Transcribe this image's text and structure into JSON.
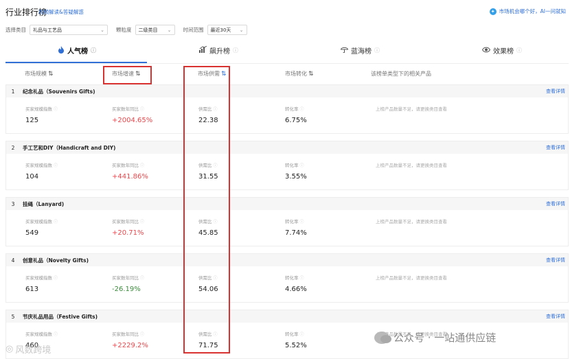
{
  "header": {
    "title": "行业排行榜",
    "guide_link": "视频解读&答疑解惑",
    "top_right_text": "市场机会哪个好，AI一问就知"
  },
  "filters": {
    "category_label": "选择类目",
    "category_value": "礼品与工艺品",
    "granularity_label": "颗粒度",
    "granularity_value": "二级类目",
    "time_label": "时间范围",
    "time_value": "最近30天"
  },
  "tabs": [
    {
      "label": "人气榜",
      "icon": "fire-icon"
    },
    {
      "label": "飙升榜",
      "icon": "rising-chart-icon"
    },
    {
      "label": "蓝海榜",
      "icon": "umbrella-icon"
    },
    {
      "label": "效果榜",
      "icon": "eye-icon"
    }
  ],
  "columns": {
    "market_scale": "市场规模",
    "market_growth": "市场增速",
    "market_supply": "市场供需",
    "market_conversion": "市场转化",
    "related_products": "该榜单类型下的相关产品"
  },
  "metric_labels": {
    "buyer_index": "买家规模指数",
    "buyer_yoy": "买家数年同比",
    "supply_ratio": "供需比",
    "conversion": "转化率"
  },
  "detail_label": "查看详情",
  "product_message": "上榜产品数量不足，请更换类目查看",
  "rows": [
    {
      "rank": "1",
      "name": "纪念礼品（Souvenirs Gifts)",
      "buyer_index": "125",
      "buyer_yoy": "+2004.65%",
      "yoy_color": "red",
      "supply_ratio": "22.38",
      "conversion": "6.75%"
    },
    {
      "rank": "2",
      "name": "手工艺和DIY（Handicraft and DIY)",
      "buyer_index": "104",
      "buyer_yoy": "+441.86%",
      "yoy_color": "red",
      "supply_ratio": "31.55",
      "conversion": "3.55%"
    },
    {
      "rank": "3",
      "name": "挂绳（Lanyard)",
      "buyer_index": "549",
      "buyer_yoy": "+20.71%",
      "yoy_color": "red",
      "supply_ratio": "45.85",
      "conversion": "7.74%"
    },
    {
      "rank": "4",
      "name": "创意礼品（Novelty Gifts)",
      "buyer_index": "613",
      "buyer_yoy": "-26.19%",
      "yoy_color": "green",
      "supply_ratio": "54.06",
      "conversion": "4.66%"
    },
    {
      "rank": "5",
      "name": "节庆礼品用品（Festive Gifts)",
      "buyer_index": "460",
      "buyer_yoy": "+2229.2%",
      "yoy_color": "red",
      "supply_ratio": "71.75",
      "conversion": "5.52%"
    }
  ],
  "watermarks": {
    "left": "风数跨境",
    "right": "公众号 · 一站通供应链"
  },
  "colors": {
    "accent": "#2f6fd6",
    "highlight": "#d93030",
    "positive": "#e8474c",
    "negative": "#3b8b3b"
  }
}
